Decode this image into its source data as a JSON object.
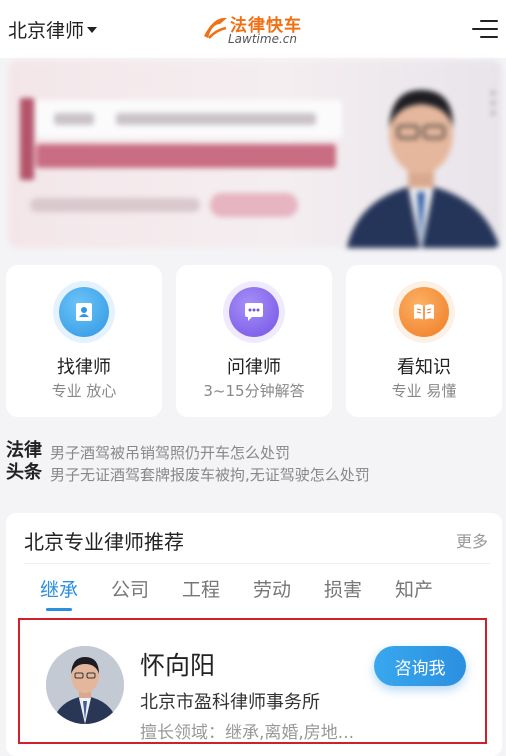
{
  "header": {
    "city": "北京律师",
    "logo_cn": "法律快车",
    "logo_en": "Lawtime.cn"
  },
  "features": [
    {
      "title": "找律师",
      "subtitle": "专业  放心",
      "icon": "contact-book-icon",
      "color": "#3aa6ea"
    },
    {
      "title": "问律师",
      "subtitle": "3~15分钟解答",
      "icon": "chat-bubble-icon",
      "color": "#8062ec"
    },
    {
      "title": "看知识",
      "subtitle": "专业  易懂",
      "icon": "open-book-icon",
      "color": "#f58a2e"
    }
  ],
  "headlines": {
    "label_line1": "法律",
    "label_line2": "头条",
    "items": [
      "男子酒驾被吊销驾照仍开车怎么处罚",
      "男子无证酒驾套牌报废车被拘,无证驾驶怎么处罚"
    ]
  },
  "recommend": {
    "title": "北京专业律师推荐",
    "more": "更多",
    "tabs": [
      "继承",
      "公司",
      "工程",
      "劳动",
      "损害",
      "知产"
    ],
    "active_tab": 0,
    "lawyer": {
      "name": "怀向阳",
      "firm": "北京市盈科律师事务所",
      "specialty": "擅长领域：继承,离婚,房地...",
      "button": "咨询我"
    }
  },
  "colors": {
    "accent_blue": "#2a8fe0",
    "logo_orange": "#f07014",
    "highlight_red": "#d0202a"
  }
}
